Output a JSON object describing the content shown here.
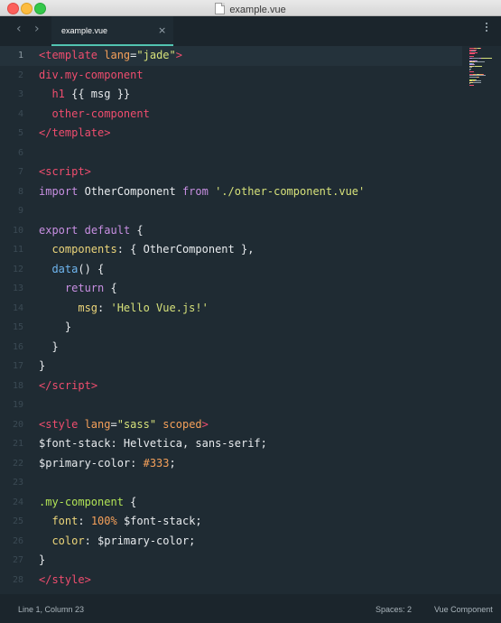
{
  "window": {
    "title": "example.vue"
  },
  "tabs": [
    {
      "label": "example.vue",
      "close": "×"
    }
  ],
  "nav": {
    "back": "‹",
    "forward": "›"
  },
  "editor": {
    "current_line": 1,
    "lines": [
      {
        "n": "1",
        "tokens": [
          {
            "t": "<",
            "c": "red"
          },
          {
            "t": "template",
            "c": "red"
          },
          {
            "t": " lang",
            "c": "orange"
          },
          {
            "t": "=",
            "c": "white"
          },
          {
            "t": "\"jade\"",
            "c": "str"
          },
          {
            "t": ">",
            "c": "red"
          }
        ]
      },
      {
        "n": "2",
        "tokens": [
          {
            "t": "div.my-component",
            "c": "red"
          }
        ]
      },
      {
        "n": "3",
        "tokens": [
          {
            "t": "  h1",
            "c": "red"
          },
          {
            "t": " {{ msg }}",
            "c": "white"
          }
        ]
      },
      {
        "n": "4",
        "tokens": [
          {
            "t": "  other-component",
            "c": "red"
          }
        ]
      },
      {
        "n": "5",
        "tokens": [
          {
            "t": "</",
            "c": "red"
          },
          {
            "t": "template",
            "c": "red"
          },
          {
            "t": ">",
            "c": "red"
          }
        ]
      },
      {
        "n": "6",
        "tokens": []
      },
      {
        "n": "7",
        "tokens": [
          {
            "t": "<",
            "c": "red"
          },
          {
            "t": "script",
            "c": "red"
          },
          {
            "t": ">",
            "c": "red"
          }
        ]
      },
      {
        "n": "8",
        "tokens": [
          {
            "t": "import",
            "c": "purple"
          },
          {
            "t": " OtherComponent ",
            "c": "white"
          },
          {
            "t": "from",
            "c": "purple"
          },
          {
            "t": " './other-component.vue'",
            "c": "str"
          }
        ]
      },
      {
        "n": "9",
        "tokens": []
      },
      {
        "n": "10",
        "tokens": [
          {
            "t": "export",
            "c": "purple"
          },
          {
            "t": " ",
            "c": "white"
          },
          {
            "t": "default",
            "c": "purple"
          },
          {
            "t": " {",
            "c": "white"
          }
        ]
      },
      {
        "n": "11",
        "tokens": [
          {
            "t": "  components",
            "c": "yellow"
          },
          {
            "t": ": { OtherComponent },",
            "c": "white"
          }
        ]
      },
      {
        "n": "12",
        "tokens": [
          {
            "t": "  data",
            "c": "blue"
          },
          {
            "t": "() {",
            "c": "white"
          }
        ]
      },
      {
        "n": "13",
        "tokens": [
          {
            "t": "    return",
            "c": "purple"
          },
          {
            "t": " {",
            "c": "white"
          }
        ]
      },
      {
        "n": "14",
        "tokens": [
          {
            "t": "      msg",
            "c": "yellow"
          },
          {
            "t": ": ",
            "c": "white"
          },
          {
            "t": "'Hello Vue.js!'",
            "c": "str"
          }
        ]
      },
      {
        "n": "15",
        "tokens": [
          {
            "t": "    }",
            "c": "white"
          }
        ]
      },
      {
        "n": "16",
        "tokens": [
          {
            "t": "  }",
            "c": "white"
          }
        ]
      },
      {
        "n": "17",
        "tokens": [
          {
            "t": "}",
            "c": "white"
          }
        ]
      },
      {
        "n": "18",
        "tokens": [
          {
            "t": "</",
            "c": "red"
          },
          {
            "t": "script",
            "c": "red"
          },
          {
            "t": ">",
            "c": "red"
          }
        ]
      },
      {
        "n": "19",
        "tokens": []
      },
      {
        "n": "20",
        "tokens": [
          {
            "t": "<",
            "c": "red"
          },
          {
            "t": "style",
            "c": "red"
          },
          {
            "t": " lang",
            "c": "orange"
          },
          {
            "t": "=",
            "c": "white"
          },
          {
            "t": "\"sass\"",
            "c": "str"
          },
          {
            "t": " scoped",
            "c": "orange"
          },
          {
            "t": ">",
            "c": "red"
          }
        ]
      },
      {
        "n": "21",
        "tokens": [
          {
            "t": "$font-stack",
            "c": "white"
          },
          {
            "t": ": Helvetica, sans-serif;",
            "c": "white"
          }
        ]
      },
      {
        "n": "22",
        "tokens": [
          {
            "t": "$primary-color",
            "c": "white"
          },
          {
            "t": ": ",
            "c": "white"
          },
          {
            "t": "#333",
            "c": "orange"
          },
          {
            "t": ";",
            "c": "white"
          }
        ]
      },
      {
        "n": "23",
        "tokens": []
      },
      {
        "n": "24",
        "tokens": [
          {
            "t": ".my-component",
            "c": "green"
          },
          {
            "t": " {",
            "c": "white"
          }
        ]
      },
      {
        "n": "25",
        "tokens": [
          {
            "t": "  font",
            "c": "yellow"
          },
          {
            "t": ": ",
            "c": "white"
          },
          {
            "t": "100%",
            "c": "orange"
          },
          {
            "t": " $font-stack;",
            "c": "white"
          }
        ]
      },
      {
        "n": "26",
        "tokens": [
          {
            "t": "  color",
            "c": "yellow"
          },
          {
            "t": ": $primary-color;",
            "c": "white"
          }
        ]
      },
      {
        "n": "27",
        "tokens": [
          {
            "t": "}",
            "c": "white"
          }
        ]
      },
      {
        "n": "28",
        "tokens": [
          {
            "t": "</",
            "c": "red"
          },
          {
            "t": "style",
            "c": "red"
          },
          {
            "t": ">",
            "c": "red"
          }
        ]
      }
    ]
  },
  "status": {
    "position": "Line 1, Column 23",
    "spaces": "Spaces: 2",
    "syntax": "Vue Component"
  },
  "colors": {
    "background": "#1f2b33",
    "tab_accent": "#52c4b1",
    "tag": "#ef4d6e",
    "string": "#d6e17a",
    "keyword": "#c88fe2"
  }
}
